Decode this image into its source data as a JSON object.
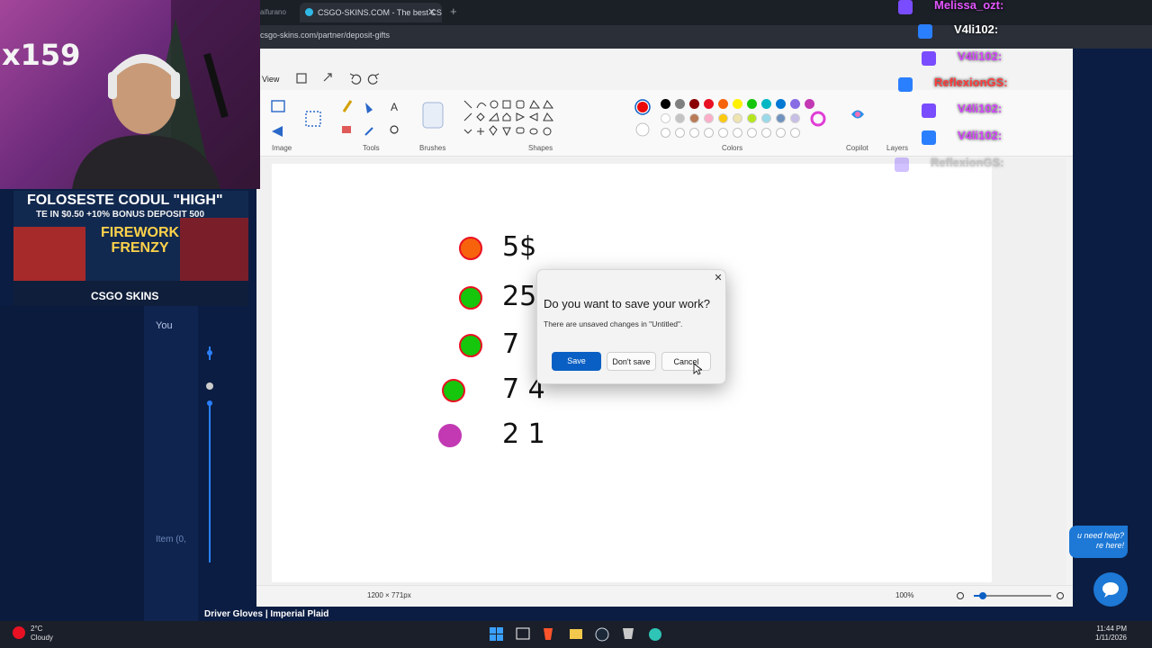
{
  "browser": {
    "tab_prev_label": "aifurano",
    "tab_active_label": "CSGO-SKINS.COM - The best CS",
    "address": "csgo-skins.com/partner/deposit-gifts"
  },
  "paint": {
    "menu_view": "View",
    "groups": {
      "image": "Image",
      "tools": "Tools",
      "brushes": "Brushes",
      "shapes": "Shapes",
      "colors": "Colors",
      "copilot": "Copilot",
      "layers": "Layers"
    },
    "palette_row1": [
      "#ea0a0a",
      "#000000",
      "#7f7f7f",
      "#8b0000",
      "#e81123",
      "#f7630c",
      "#fff100",
      "#16c60c",
      "#00b7c3",
      "#0078d4",
      "#886ce4",
      "#c239b3"
    ],
    "palette_row2": [
      "#ffffff",
      "#c3c3c3",
      "#b97a57",
      "#ffaec9",
      "#ffc90e",
      "#efe4b0",
      "#b5e61d",
      "#99d9ea",
      "#7092be",
      "#c8bfe7"
    ],
    "status_size": "1200 × 771px",
    "status_zoom": "100%"
  },
  "dialog": {
    "title": "Do you want to save your work?",
    "message": "There are unsaved changes in \"Untitled\".",
    "save": "Save",
    "dont_save": "Don't save",
    "cancel": "Cancel"
  },
  "drawing": {
    "rows": [
      {
        "circle_color": "#f7630c",
        "text": "5$"
      },
      {
        "circle_color": "#16c60c",
        "text": "25"
      },
      {
        "circle_color": "#16c60c",
        "text": "7"
      },
      {
        "circle_color": "#16c60c",
        "text": "7 4"
      },
      {
        "circle_color": "#c239b3",
        "text": "2 1"
      }
    ]
  },
  "stream": {
    "counter": "x159",
    "ad_line1": "FOLOSESTE CODUL \"HIGH\"",
    "ad_line2": "TE IN $0.50 +10% BONUS DEPOSIT 500",
    "ad_line3a": "FIREWORK",
    "ad_line3b": "FRENZY",
    "ad_brand": "CSGO SKINS",
    "chat": [
      {
        "user": "Melissa_ozt:",
        "color": "#e455ff"
      },
      {
        "user": "V4li102:",
        "color": "#ffffff"
      },
      {
        "user": "V4li102:",
        "color": "#d648ff"
      },
      {
        "user": "ReflexionGS:",
        "color": "#ff3b3b"
      },
      {
        "user": "V4li102:",
        "color": "#d648ff"
      },
      {
        "user": "V4li102:",
        "color": "#d648ff"
      },
      {
        "user": "ReflexionGS:",
        "color": "#777777"
      }
    ]
  },
  "site": {
    "you_label": "You",
    "item_label": "Item (0,",
    "product": "Driver Gloves | Imperial Plaid",
    "help_text": "u need help? re here!"
  },
  "taskbar": {
    "temp": "2°C",
    "weather": "Cloudy",
    "time": "11:44 PM",
    "date": "1/11/2026"
  }
}
